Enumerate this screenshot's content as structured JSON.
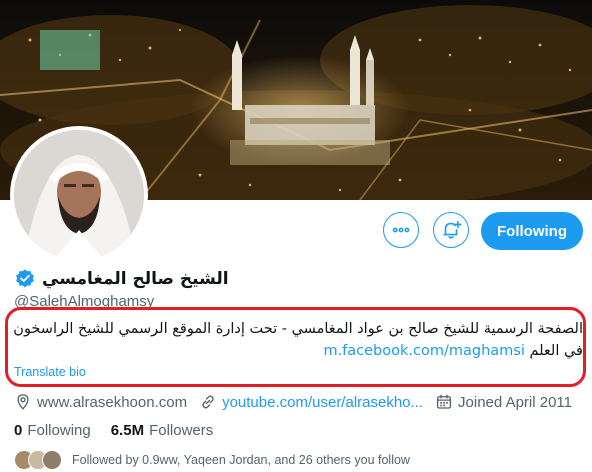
{
  "profile": {
    "display_name": "الشيخ صالح المغامسي",
    "handle": "@SalehAlmoghamsy",
    "follow_button": "Following",
    "bio_line1": "الصفحة الرسمية للشيخ صالح بن عواد المغامسي - تحت إدارة الموقع الرسمي للشيخ الراسخون",
    "bio_line2_text": "في العلم",
    "bio_link": "m.facebook.com/maghamsi",
    "translate": "Translate bio",
    "website": "www.alrasekhoon.com",
    "youtube": "youtube.com/user/alrasekho...",
    "joined": "Joined April 2011",
    "following_count": "0",
    "following_label": "Following",
    "followers_count": "6.5M",
    "followers_label": "Followers",
    "followed_by": "Followed by 0.9ww, Yaqeen Jordan, and 26 others you follow"
  },
  "colors": {
    "accent": "#1d9bf0",
    "highlight_border": "#e21f26",
    "secondary_text": "#536471"
  },
  "icons": [
    "more-icon",
    "notification-add-icon",
    "verified-icon",
    "location-icon",
    "link-icon",
    "calendar-icon"
  ]
}
